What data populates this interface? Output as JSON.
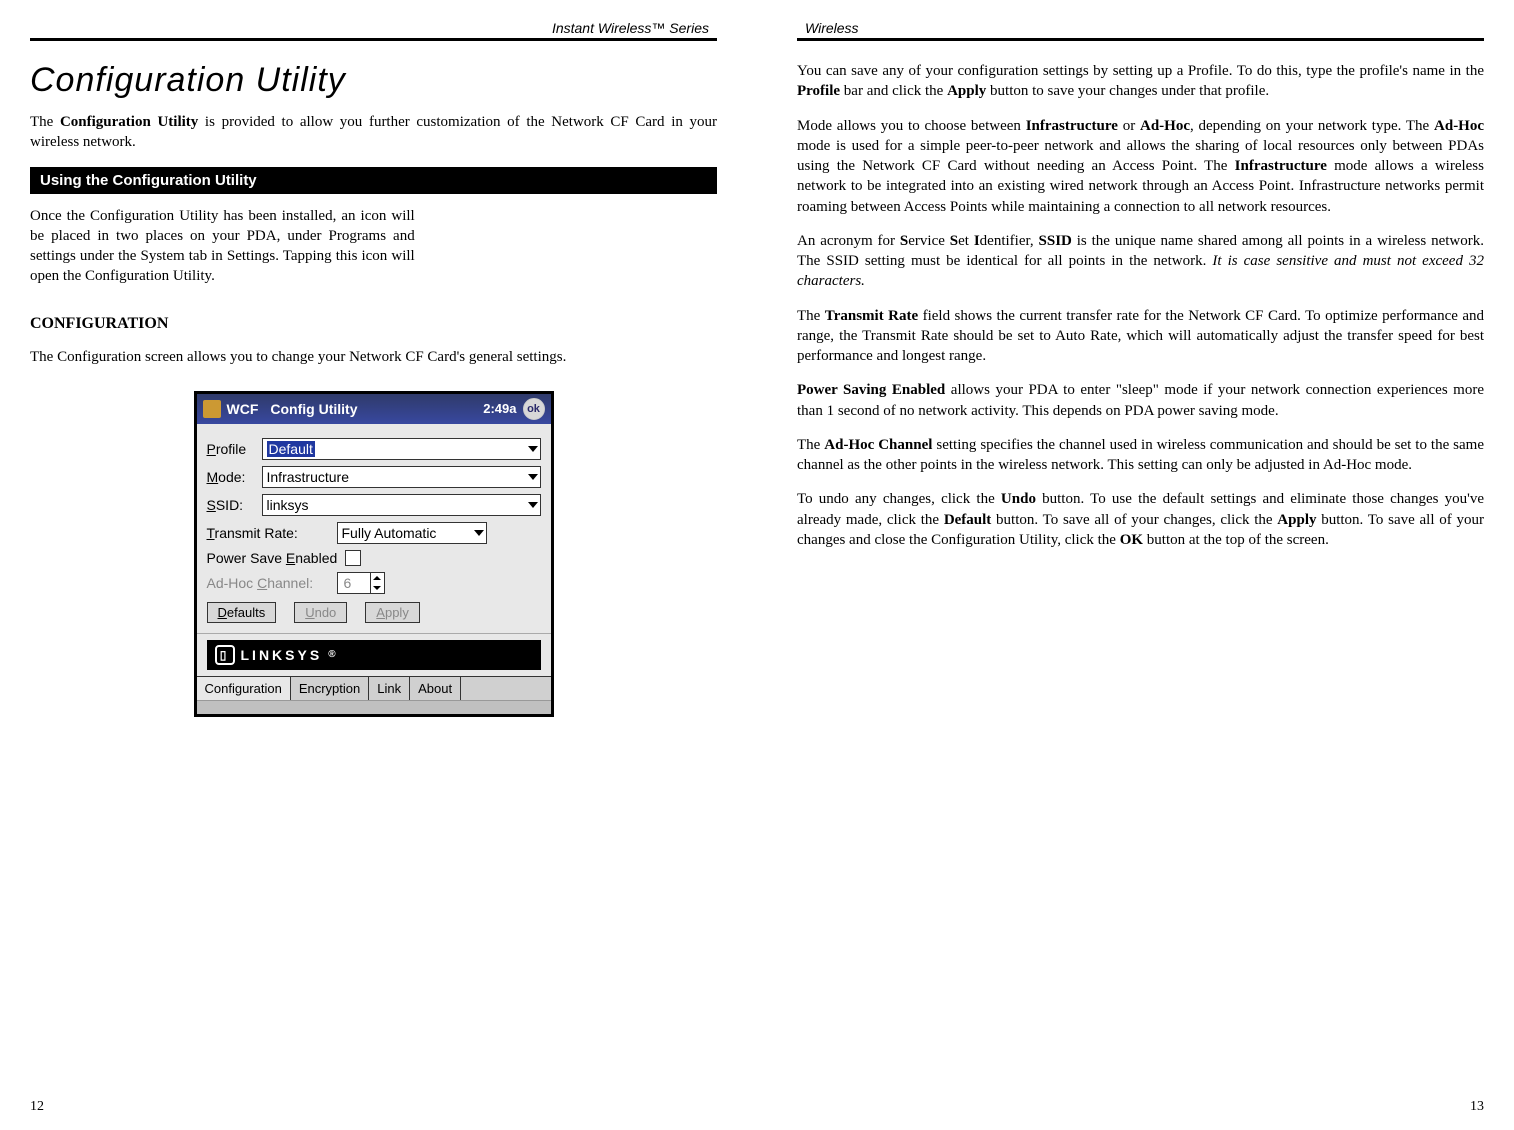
{
  "headers": {
    "left": "Instant Wireless™ Series",
    "right": "Wireless"
  },
  "page_numbers": {
    "left": "12",
    "right": "13"
  },
  "left_page": {
    "title": "Configuration Utility",
    "intro_pre": "The ",
    "intro_bold": "Configuration Utility",
    "intro_post": " is provided to allow you further customization of the Network CF Card in your wireless network.",
    "section_bar": "Using the Configuration Utility",
    "para1": "Once the Configuration Utility has been installed, an icon will be placed in two places on your PDA, under Programs and settings under the System tab in Settings. Tapping this icon will open the Configuration Utility.",
    "subheading": "CONFIGURATION",
    "para2": "The Configuration screen allows you to change your Network CF Card's general settings."
  },
  "pda": {
    "app": "WCF",
    "title": "Config Utility",
    "time": "2:49a",
    "ok": "ok",
    "labels": {
      "profile": "Profile",
      "mode": "Mode:",
      "ssid": "SSID:",
      "transmit_rate": "Transmit Rate:",
      "power_save": "Power Save Enabled",
      "adhoc_channel": "Ad-Hoc Channel:"
    },
    "values": {
      "profile": "Default",
      "mode": "Infrastructure",
      "ssid": "linksys",
      "transmit_rate": "Fully Automatic",
      "adhoc_channel": "6"
    },
    "buttons": {
      "defaults": "Defaults",
      "undo": "Undo",
      "apply": "Apply"
    },
    "brand": "LINKSYS",
    "tabs": [
      "Configuration",
      "Encryption",
      "Link",
      "About"
    ]
  },
  "right_page": {
    "p1_a": "You can save any of your configuration settings by setting up a Profile. To do this, type the profile's name in the ",
    "p1_b1": "Profile",
    "p1_c": " bar and click the ",
    "p1_b2": "Apply",
    "p1_d": " button to save your changes under that profile.",
    "p2_a": "Mode allows you to choose between ",
    "p2_b1": "Infrastructure",
    "p2_c": " or ",
    "p2_b2": "Ad-Hoc",
    "p2_d": ", depending on your network type. The ",
    "p2_b3": "Ad-Hoc",
    "p2_e": " mode is used for a simple peer-to-peer network and allows the sharing of local resources only between PDAs using the Network CF Card without needing an Access Point. The ",
    "p2_b4": "Infrastructure",
    "p2_f": " mode allows a wireless network to be integrated into an existing wired network through an Access Point. Infrastructure networks permit roaming between Access Points while maintaining a connection to all network resources.",
    "p3_a": "An acronym for ",
    "p3_b1": "S",
    "p3_c": "ervice ",
    "p3_b2": "S",
    "p3_d": "et ",
    "p3_b3": "I",
    "p3_e": "dentifier, ",
    "p3_b4": "SSID",
    "p3_f": " is the unique name shared among all points in a wireless network. The SSID setting must be identical for all points in the network. ",
    "p3_italic": "It is case sensitive and must not exceed 32 characters.",
    "p4_a": "The ",
    "p4_b1": "Transmit  Rate",
    "p4_c": " field shows the current transfer rate for the Network CF Card. To optimize performance and range, the Transmit Rate should be set to Auto Rate, which will automatically adjust the transfer speed for best performance and longest range.",
    "p5_b1": "Power Saving Enabled",
    "p5_a": " allows your PDA to enter \"sleep\" mode if your network connection experiences more than 1 second of no network activity. This depends on PDA power saving mode.",
    "p6_a": "The ",
    "p6_b1": "Ad-Hoc Channel",
    "p6_c": " setting specifies the channel used in wireless communication and should be set to the same channel as the other points in the wireless network. This setting can only be adjusted in Ad-Hoc mode.",
    "p7_a": "To undo any changes, click the ",
    "p7_b1": "Undo",
    "p7_c": " button. To use the default settings and eliminate those changes you've already made, click the ",
    "p7_b2": "Default",
    "p7_d": " button. To save all of your changes, click the ",
    "p7_b3": "Apply",
    "p7_e": " button. To save all of your changes and close the Configuration Utility, click the ",
    "p7_b4": "OK",
    "p7_f": " button at the top of the screen."
  }
}
